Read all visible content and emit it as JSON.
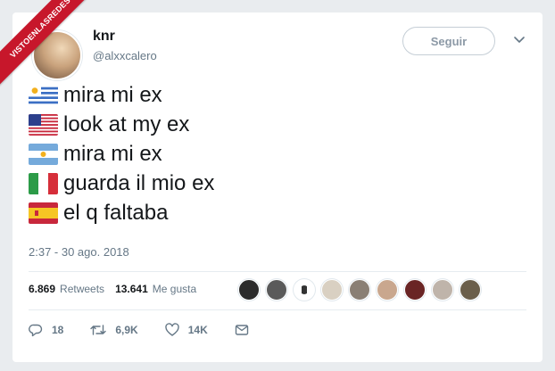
{
  "banner": {
    "text": "VISTOENLASREDES"
  },
  "user": {
    "display_name": "knr",
    "handle": "@alxxcalero"
  },
  "follow_button": {
    "label": "Seguir"
  },
  "tweet": {
    "lines": [
      {
        "flag": "uruguay-flag",
        "text": " mira mi ex"
      },
      {
        "flag": "usa-flag",
        "text": "look at my ex"
      },
      {
        "flag": "argentina-flag",
        "text": " mira mi ex"
      },
      {
        "flag": "italy-flag",
        "text": "guarda il mio ex"
      },
      {
        "flag": "spain-flag",
        "text": " el q faltaba"
      }
    ],
    "timestamp": "2:37 - 30 ago. 2018"
  },
  "stats": {
    "retweets_count": "6.869",
    "retweets_label": "Retweets",
    "likes_count": "13.641",
    "likes_label": "Me gusta"
  },
  "actions": {
    "reply_count": "18",
    "retweet_count": "6,9K",
    "like_count": "14K"
  },
  "colors": {
    "text": "#14171a",
    "secondary": "#657786",
    "banner": "#c7172b",
    "background": "#e9ecef"
  }
}
